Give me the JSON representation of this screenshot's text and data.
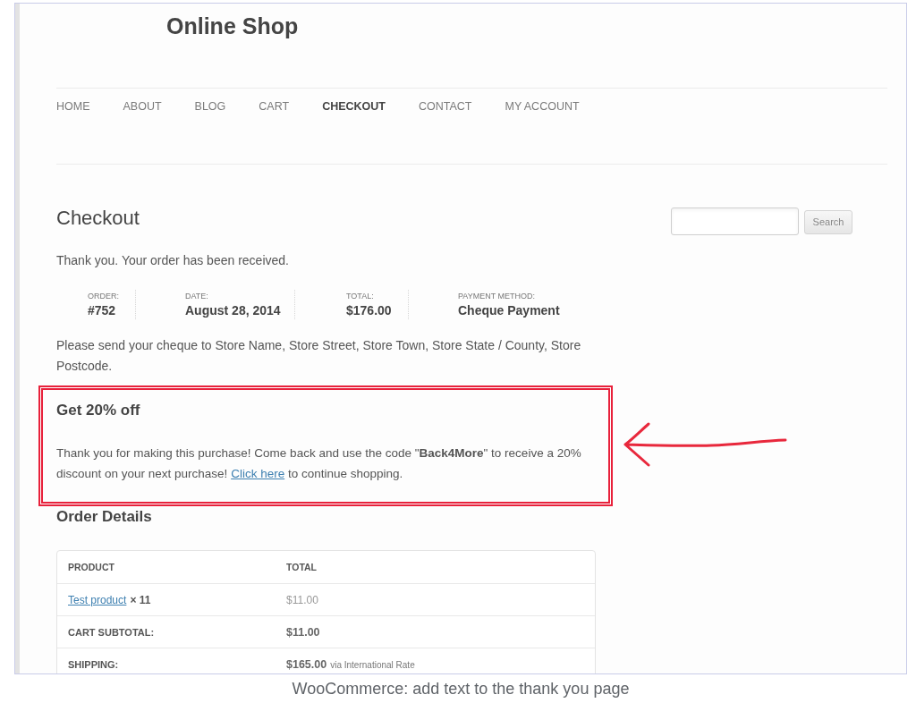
{
  "site": {
    "title": "Online Shop"
  },
  "nav": [
    {
      "label": "HOME",
      "selected": false
    },
    {
      "label": "ABOUT",
      "selected": false
    },
    {
      "label": "BLOG",
      "selected": false
    },
    {
      "label": "CART",
      "selected": false
    },
    {
      "label": "CHECKOUT",
      "selected": true
    },
    {
      "label": "CONTACT",
      "selected": false
    },
    {
      "label": "MY ACCOUNT",
      "selected": false
    }
  ],
  "page": {
    "title": "Checkout",
    "notice": "Thank you. Your order has been received.",
    "order_overview": [
      {
        "label": "ORDER:",
        "value": "#752"
      },
      {
        "label": "DATE:",
        "value": "August 28, 2014"
      },
      {
        "label": "TOTAL:",
        "value": "$176.00"
      },
      {
        "label": "PAYMENT METHOD:",
        "value": "Cheque Payment"
      }
    ],
    "instructions": "Please send your cheque to Store Name, Store Street, Store Town, Store State / County, Store Postcode."
  },
  "promo": {
    "highlighted": true,
    "title": "Get 20% off",
    "text_before": "Thank you for making this purchase! Come back and use the code \"**Back4More**\" to receive a 20% discount on your next purchase!",
    "link": "Click here",
    "text_after": "to continue shopping."
  },
  "order_details": {
    "title": "Order Details",
    "columns": [
      "PRODUCT",
      "TOTAL"
    ],
    "rows": [
      {
        "kind": "item",
        "label": "Test product",
        "quantity": "× 11",
        "value": "$11.00"
      },
      {
        "kind": "total",
        "label": "CART SUBTOTAL:",
        "value": "$11.00"
      },
      {
        "kind": "total",
        "label": "SHIPPING:",
        "value": "$165.00",
        "note": "via International Rate"
      }
    ]
  },
  "sidebar": {
    "search_button": "Search"
  },
  "caption": "WooCommerce: add text to the thank you page"
}
